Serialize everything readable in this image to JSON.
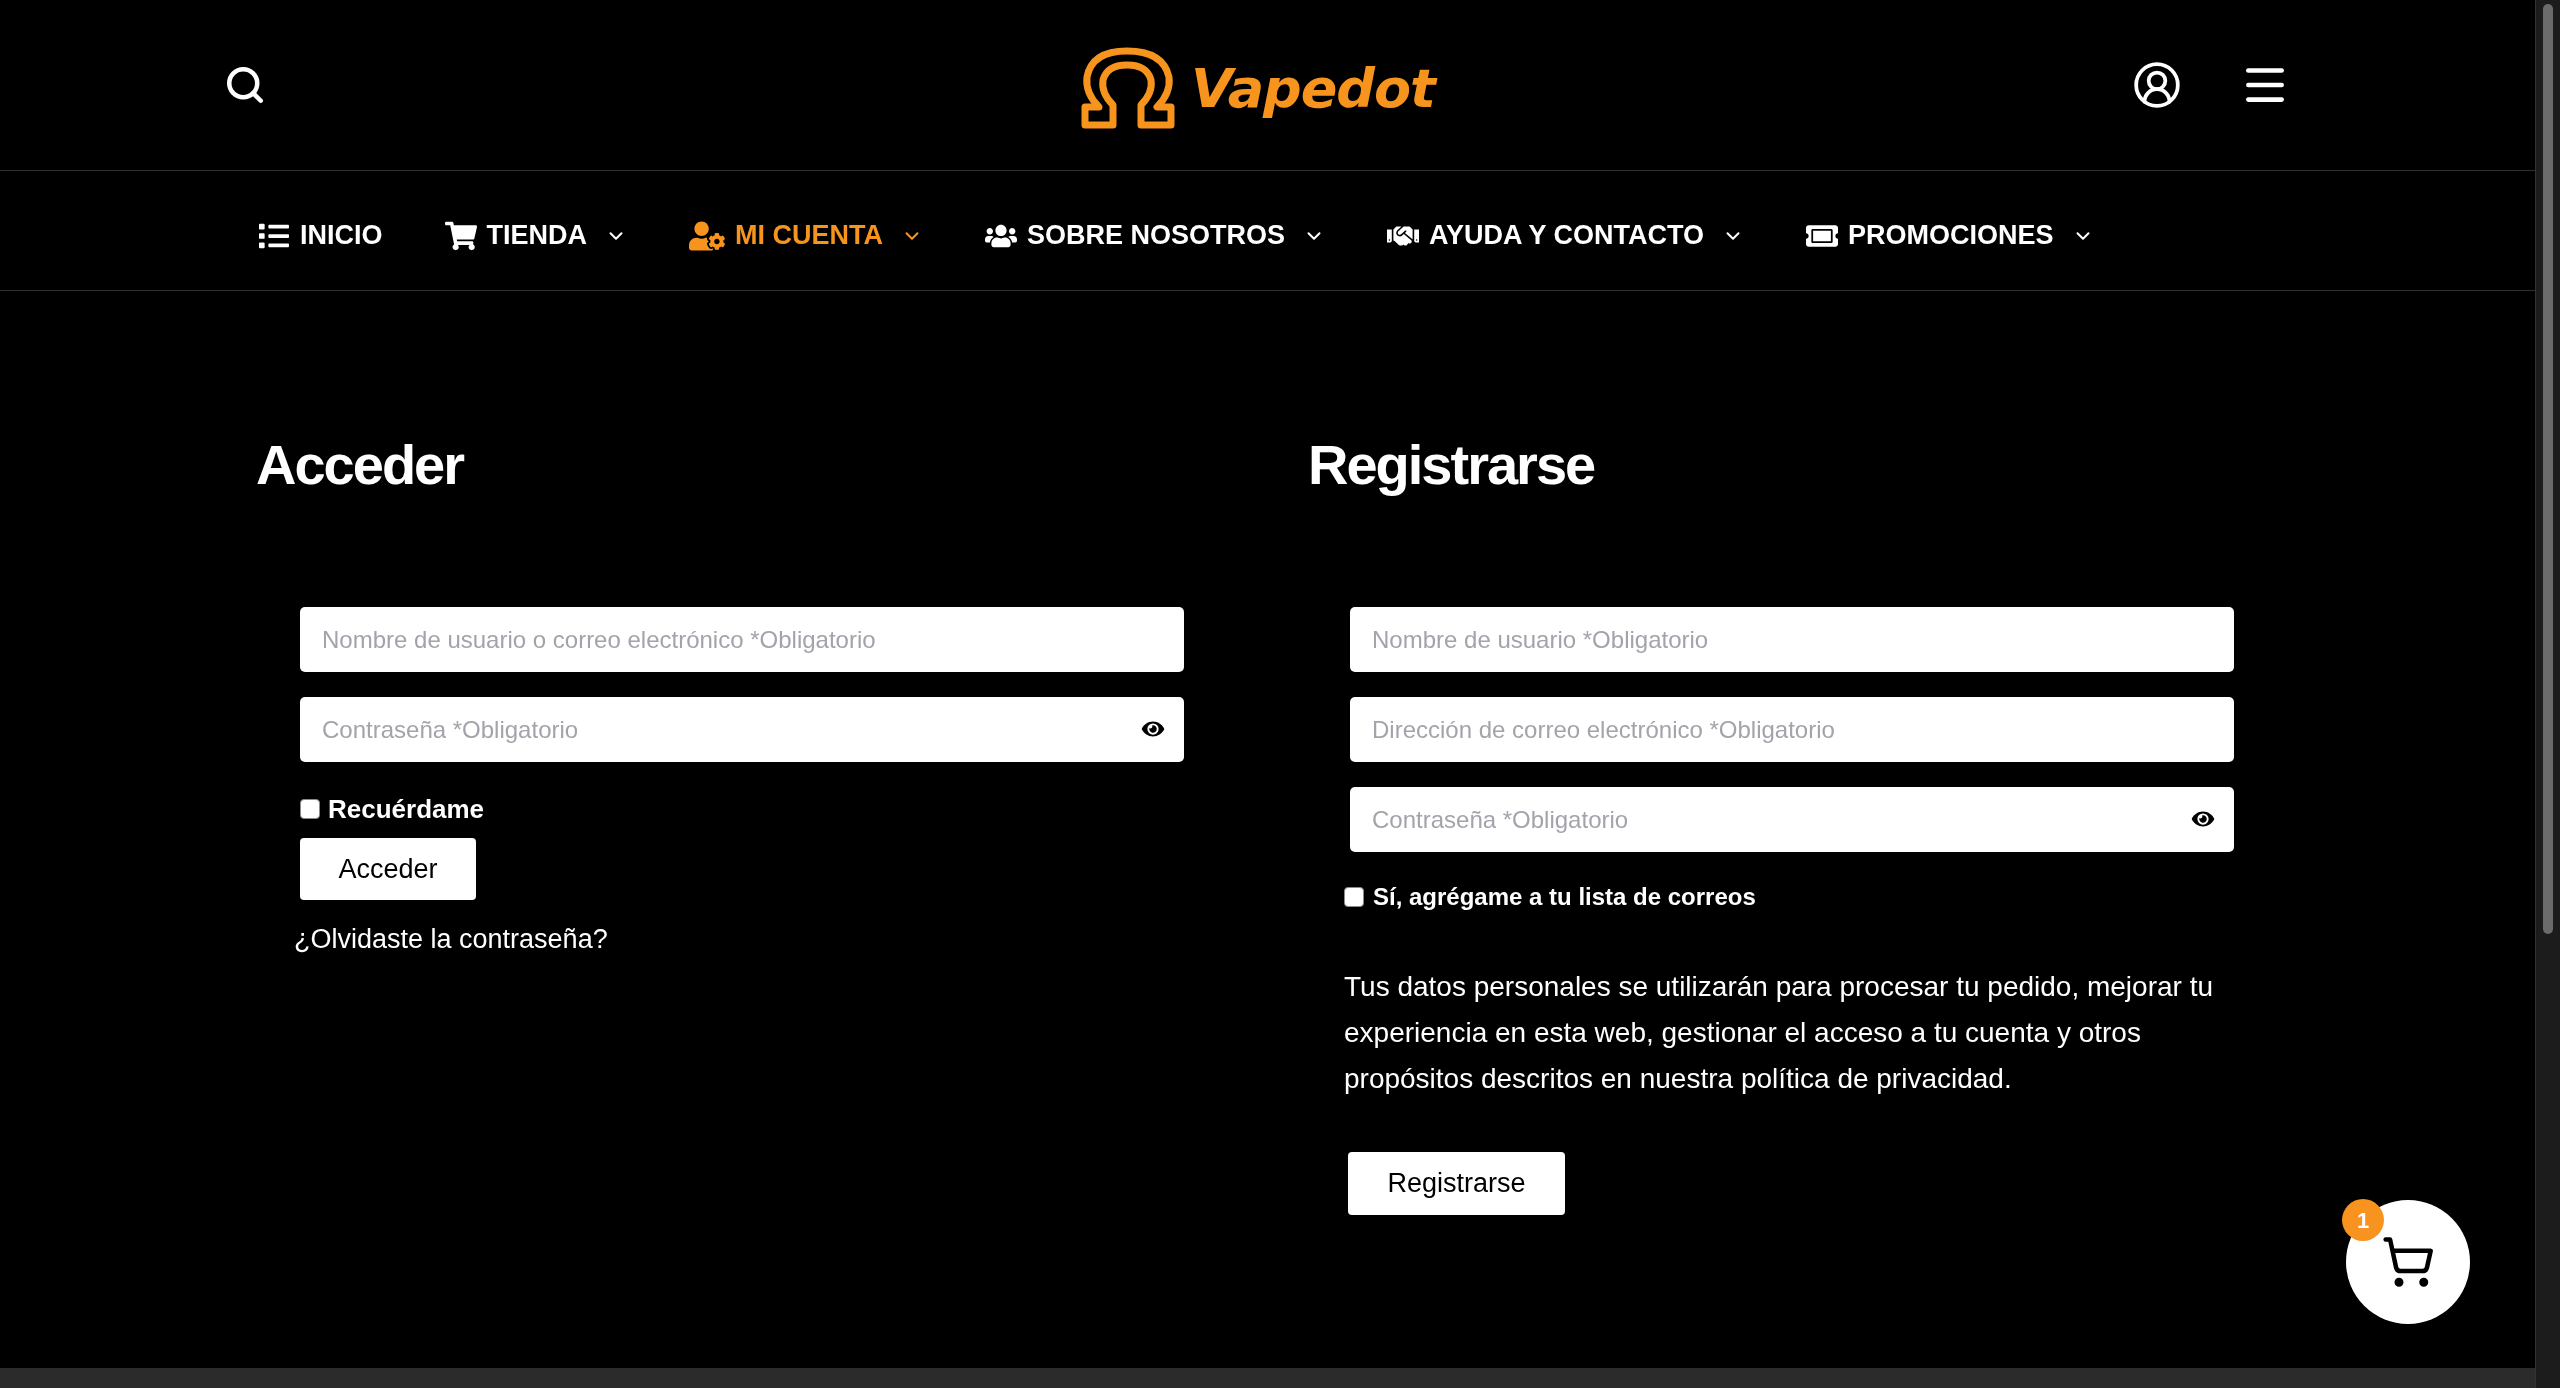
{
  "header": {
    "logo": {
      "text": "Vapedot"
    }
  },
  "nav": {
    "items": [
      {
        "label": "INICIO",
        "selected": false,
        "has_submenu": false
      },
      {
        "label": "TIENDA",
        "selected": false,
        "has_submenu": true
      },
      {
        "label": "MI CUENTA",
        "selected": true,
        "has_submenu": true
      },
      {
        "label": "SOBRE NOSOTROS",
        "selected": false,
        "has_submenu": true
      },
      {
        "label": "AYUDA Y CONTACTO",
        "selected": false,
        "has_submenu": true
      },
      {
        "label": "PROMOCIONES",
        "selected": false,
        "has_submenu": true
      }
    ]
  },
  "login": {
    "title": "Acceder",
    "fields": [
      {
        "kind": "text",
        "placeholder": "Nombre de usuario o correo electrónico *Obligatorio"
      },
      {
        "kind": "password",
        "placeholder": "Contraseña *Obligatorio"
      }
    ],
    "remember": {
      "label": "Recuérdame",
      "checked": false
    },
    "submit": "Acceder",
    "forgot_link": "¿Olvidaste la contraseña?"
  },
  "register": {
    "title": "Registrarse",
    "fields": [
      {
        "kind": "text",
        "placeholder": "Nombre de usuario *Obligatorio"
      },
      {
        "kind": "email",
        "placeholder": "Dirección de correo electrónico *Obligatorio"
      },
      {
        "kind": "password",
        "placeholder": "Contraseña *Obligatorio"
      }
    ],
    "newsletter": {
      "label": "Sí, agrégame a tu lista de correos",
      "checked": false
    },
    "privacy_text": "Tus datos personales se utilizarán para procesar tu pedido, mejorar tu experiencia en esta web, gestionar el acceso a tu cuenta y otros propósitos descritos en nuestra política de privacidad.",
    "submit": "Registrarse"
  },
  "cart": {
    "count": "1"
  }
}
